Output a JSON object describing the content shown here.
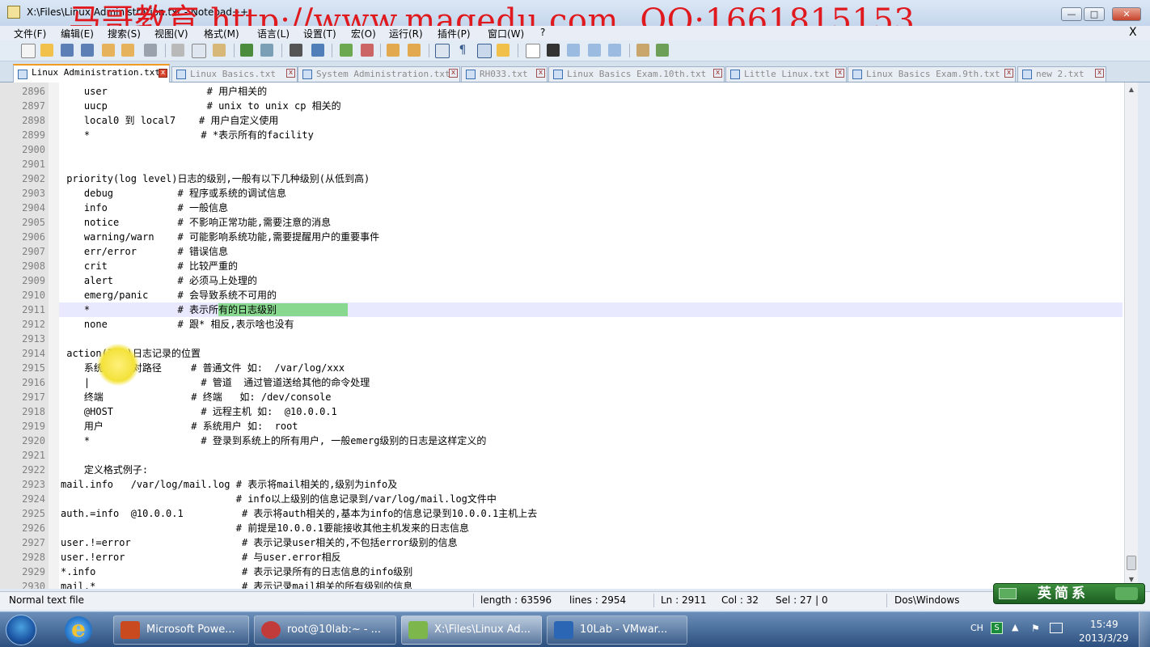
{
  "window": {
    "title": "X:\\Files\\Linux Administration.txt - Notepad++",
    "watermark": "马哥教育 http://www.magedu.com, QQ:1661815153",
    "min_label": "—",
    "max_label": "□",
    "close_label": "✕",
    "menu_close": "X"
  },
  "menu": [
    "文件(F)",
    "编辑(E)",
    "搜索(S)",
    "视图(V)",
    "格式(M)",
    "语言(L)",
    "设置(T)",
    "宏(O)",
    "运行(R)",
    "插件(P)",
    "窗口(W)",
    "?"
  ],
  "tabs": [
    {
      "label": "Linux Administration.txt",
      "active": true
    },
    {
      "label": "Linux Basics.txt",
      "active": false
    },
    {
      "label": "System Administration.txt",
      "active": false
    },
    {
      "label": "RH033.txt",
      "active": false
    },
    {
      "label": "Linux Basics Exam.10th.txt",
      "active": false
    },
    {
      "label": "Little Linux.txt",
      "active": false
    },
    {
      "label": "Linux Basics Exam.9th.txt",
      "active": false
    },
    {
      "label": "new  2.txt",
      "active": false
    }
  ],
  "editor": {
    "lines": [
      {
        "num": "2896",
        "text": "    user                 # 用户相关的"
      },
      {
        "num": "2897",
        "text": "    uucp                 # unix to unix cp 相关的"
      },
      {
        "num": "2898",
        "text": "    local0 到 local7    # 用户自定义使用"
      },
      {
        "num": "2899",
        "text": "    *                   # *表示所有的facility"
      },
      {
        "num": "2900",
        "text": ""
      },
      {
        "num": "2901",
        "text": ""
      },
      {
        "num": "2902",
        "text": " priority(log level)日志的级别,一般有以下几种级别(从低到高)"
      },
      {
        "num": "2903",
        "text": "    debug           # 程序或系统的调试信息"
      },
      {
        "num": "2904",
        "text": "    info            # 一般信息"
      },
      {
        "num": "2905",
        "text": "    notice          # 不影响正常功能,需要注意的消息"
      },
      {
        "num": "2906",
        "text": "    warning/warn    # 可能影响系统功能,需要提醒用户的重要事件"
      },
      {
        "num": "2907",
        "text": "    err/error       # 错误信息"
      },
      {
        "num": "2908",
        "text": "    crit            # 比较严重的"
      },
      {
        "num": "2909",
        "text": "    alert           # 必须马上处理的"
      },
      {
        "num": "2910",
        "text": "    emerg/panic     # 会导致系统不可用的"
      },
      {
        "num": "2911",
        "text": "    *               # 表示所有的日志级别"
      },
      {
        "num": "2912",
        "text": "    none            # 跟* 相反,表示啥也没有"
      },
      {
        "num": "2913",
        "text": ""
      },
      {
        "num": "2914",
        "text": " action(动作)日志记录的位置"
      },
      {
        "num": "2915",
        "text": "    系统上的绝对路径     # 普通文件 如:  /var/log/xxx"
      },
      {
        "num": "2916",
        "text": "    |                   # 管道  通过管道送给其他的命令处理"
      },
      {
        "num": "2917",
        "text": "    终端               # 终端   如: /dev/console"
      },
      {
        "num": "2918",
        "text": "    @HOST               # 远程主机 如:  @10.0.0.1"
      },
      {
        "num": "2919",
        "text": "    用户               # 系统用户 如:  root"
      },
      {
        "num": "2920",
        "text": "    *                   # 登录到系统上的所有用户, 一般emerg级别的日志是这样定义的"
      },
      {
        "num": "2921",
        "text": ""
      },
      {
        "num": "2922",
        "text": "    定义格式例子:"
      },
      {
        "num": "2923",
        "text": "mail.info   /var/log/mail.log # 表示将mail相关的,级别为info及"
      },
      {
        "num": "2924",
        "text": "                              # info以上级别的信息记录到/var/log/mail.log文件中"
      },
      {
        "num": "2925",
        "text": "auth.=info  @10.0.0.1          # 表示将auth相关的,基本为info的信息记录到10.0.0.1主机上去"
      },
      {
        "num": "2926",
        "text": "                              # 前提是10.0.0.1要能接收其他主机发来的日志信息"
      },
      {
        "num": "2927",
        "text": "user.!=error                   # 表示记录user相关的,不包括error级别的信息"
      },
      {
        "num": "2928",
        "text": "user.!error                    # 与user.error相反"
      },
      {
        "num": "2929",
        "text": "*.info                         # 表示记录所有的日志信息的info级别"
      },
      {
        "num": "2930",
        "text": "mail.*                         # 表示记录mail相关的所有级别的信息"
      }
    ]
  },
  "status": {
    "file_type": "Normal text file",
    "length": "length : 63596",
    "lines": "lines : 2954",
    "ln": "Ln : 2911",
    "col": "Col : 32",
    "sel": "Sel : 27 | 0",
    "eol": "Dos\\Windows"
  },
  "ime": {
    "text": "英简系"
  },
  "taskbar": {
    "items": [
      {
        "label": "Microsoft Powe...",
        "icon": "powerpoint-icon",
        "color": "#c94a1f"
      },
      {
        "label": "root@10lab:~ - ...",
        "icon": "terminal-icon",
        "color": "#c23b3b"
      },
      {
        "label": "X:\\Files\\Linux Ad...",
        "icon": "notepadpp-icon",
        "color": "#7db64a",
        "active": true
      },
      {
        "label": "10Lab - VMwar...",
        "icon": "vmware-icon",
        "color": "#2a66b3"
      }
    ],
    "tray_lang": "CH",
    "tray_s": "S",
    "time": "15:49",
    "date": "2013/3/29"
  },
  "colors": {
    "accent_tab": "#f19b20",
    "selection": "#6ad36a",
    "current_line": "#e8e8ff"
  }
}
